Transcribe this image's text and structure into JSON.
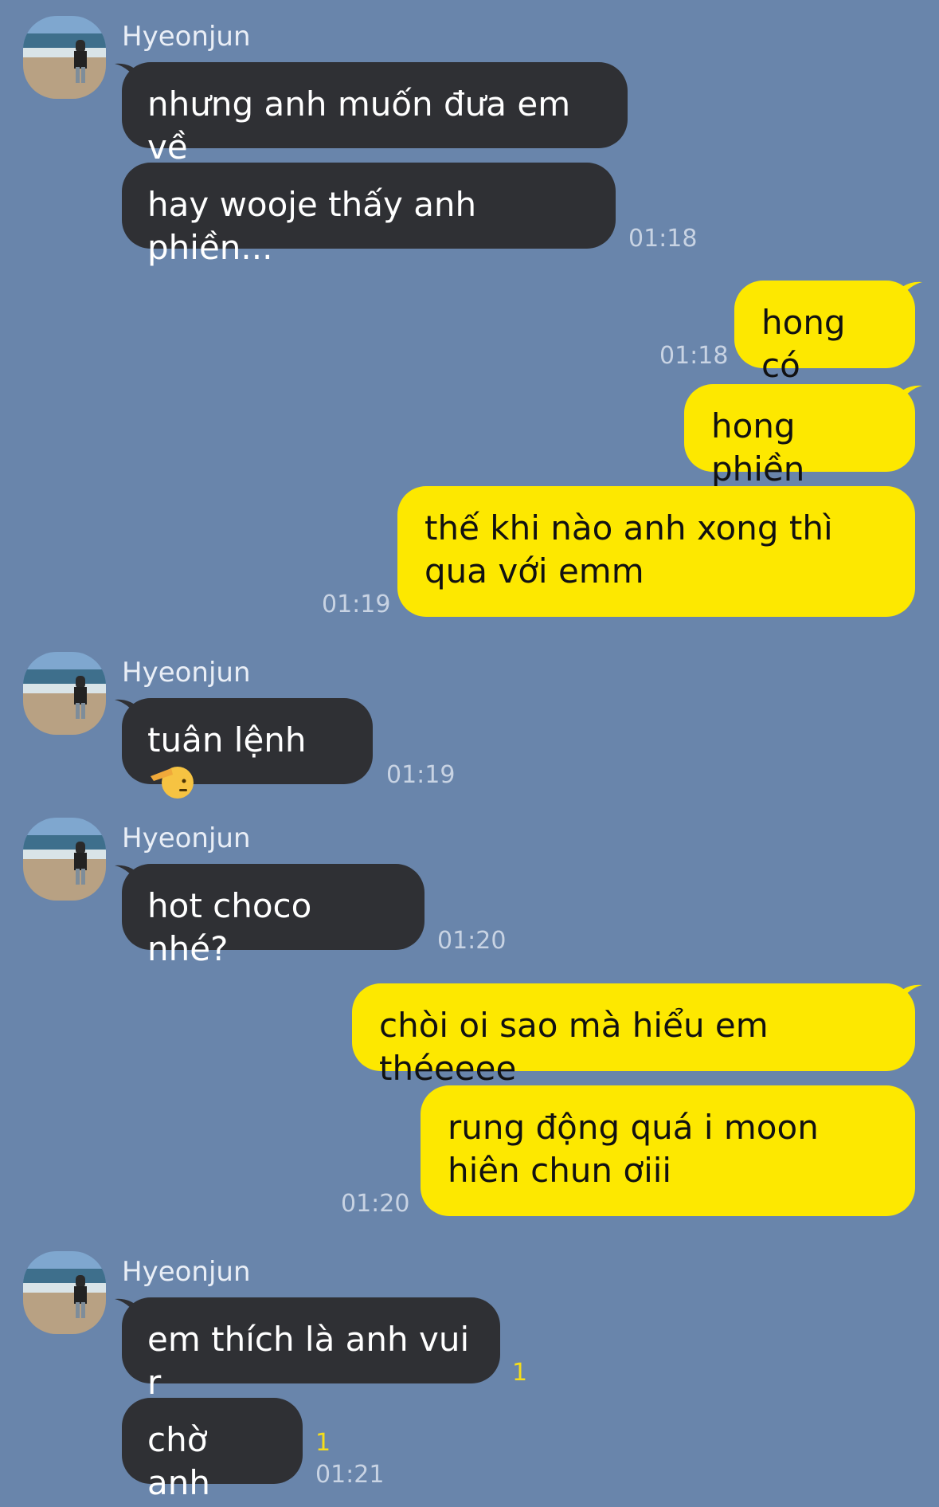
{
  "conversation": {
    "groups": [
      {
        "sender": "Hyeonjun",
        "messages": [
          "nhưng anh muốn đưa em về",
          "hay wooje thấy anh phiền..."
        ],
        "time": "01:18"
      },
      {
        "sender": "me",
        "messages": [
          "hong có",
          "hong phiền"
        ],
        "time": "01:18"
      },
      {
        "sender": "me",
        "messages": [
          "thế khi nào anh xong thì qua với emm"
        ],
        "time": "01:19"
      },
      {
        "sender": "Hyeonjun",
        "messages": [
          "tuân lệnh"
        ],
        "emoji": "saluting-face-emoji",
        "time": "01:19"
      },
      {
        "sender": "Hyeonjun",
        "messages": [
          "hot choco nhé?"
        ],
        "time": "01:20"
      },
      {
        "sender": "me",
        "messages": [
          "chòi oi sao mà hiểu em théeeee",
          "rung động quá i moon hiên chun ơiii"
        ],
        "time": "01:20"
      },
      {
        "sender": "Hyeonjun",
        "messages": [
          "em thích là anh vui r",
          "chờ anh"
        ],
        "unread": [
          "1",
          "1"
        ],
        "time": "01:21"
      }
    ],
    "contact_name": "Hyeonjun",
    "colors": {
      "background": "#6985ab",
      "incoming_bubble": "#2f3034",
      "outgoing_bubble": "#fde800",
      "unread_count": "#f5dd1a"
    }
  }
}
